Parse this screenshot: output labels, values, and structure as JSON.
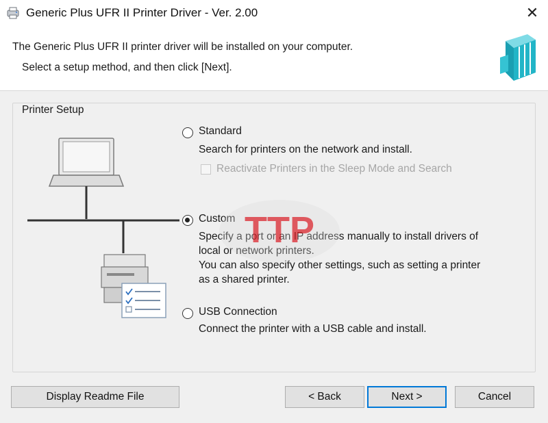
{
  "window": {
    "title": "Generic Plus UFR II Printer Driver - Ver. 2.00",
    "close_label": "✕"
  },
  "header": {
    "line1": "The Generic Plus UFR II printer driver will be installed on your computer.",
    "line2": "Select a setup method, and then click [Next]."
  },
  "printer_setup": {
    "group_title": "Printer Setup",
    "options": [
      {
        "label": "Standard",
        "selected": false,
        "description": [
          "Search for printers on the network and install."
        ],
        "sub_checkbox": {
          "label": "Reactivate Printers in the Sleep Mode and Search",
          "checked": false,
          "enabled": false
        }
      },
      {
        "label": "Custom",
        "selected": true,
        "description": [
          "Specify a port or an IP address manually to install drivers of",
          "local or network printers.",
          "You can also specify other settings, such as setting a printer",
          "as a shared printer."
        ]
      },
      {
        "label": "USB Connection",
        "selected": false,
        "description": [
          "Connect the printer with a USB cable and install."
        ]
      }
    ]
  },
  "watermark": {
    "text": "TTP"
  },
  "buttons": {
    "readme": "Display Readme File",
    "back": "< Back",
    "next": "Next >",
    "cancel": "Cancel"
  },
  "icons": {
    "app": "printer-app-icon",
    "header": "canon-printer-driver-icon",
    "illustration": "network-printer-diagram"
  },
  "colors": {
    "accent": "#0078d7",
    "logo_teal": "#22b5c7",
    "watermark_red": "#d81f26"
  }
}
